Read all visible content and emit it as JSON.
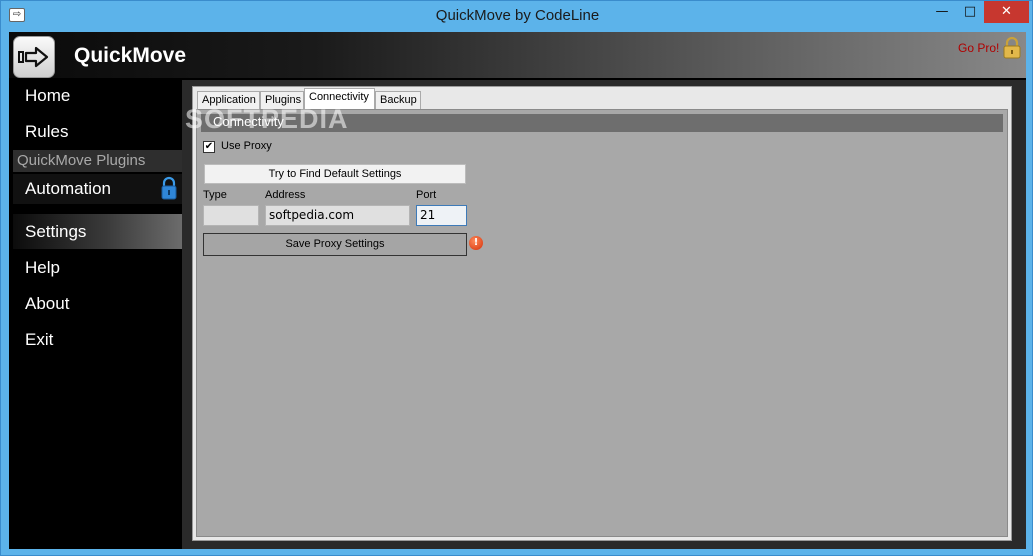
{
  "window": {
    "title": "QuickMove by CodeLine",
    "controls": {
      "minimize": "—",
      "maximize": "□",
      "close": "✕"
    }
  },
  "header": {
    "app_name": "QuickMove",
    "go_pro": "Go Pro!",
    "logo_icon": "arrow-right-icon"
  },
  "sidebar": {
    "items": [
      {
        "label": "Home"
      },
      {
        "label": "Rules"
      }
    ],
    "plugins_section": "QuickMove Plugins",
    "plugins": [
      {
        "label": "Automation",
        "icon": "lock-icon"
      }
    ],
    "bottom_items": [
      {
        "label": "Settings",
        "active": true
      },
      {
        "label": "Help"
      },
      {
        "label": "About"
      },
      {
        "label": "Exit"
      }
    ]
  },
  "tabs": [
    {
      "label": "Application"
    },
    {
      "label": "Plugins"
    },
    {
      "label": "Connectivity",
      "active": true
    },
    {
      "label": "Backup"
    }
  ],
  "connectivity": {
    "section_title": "Connectivity",
    "watermark": "SOFTPEDIA",
    "use_proxy_label": "Use Proxy",
    "use_proxy_checked": true,
    "find_defaults_button": "Try to Find Default Settings",
    "type_label": "Type",
    "type_value": "",
    "address_label": "Address",
    "address_value": "softpedia.com",
    "port_label": "Port",
    "port_value": "21",
    "save_button": "Save Proxy Settings",
    "warning_icon": "exclamation-icon"
  },
  "colors": {
    "title_bar": "#5cb3ea",
    "close_button": "#c7372f",
    "go_pro_text": "#b00000",
    "panel_gray": "#a8a8a8"
  }
}
